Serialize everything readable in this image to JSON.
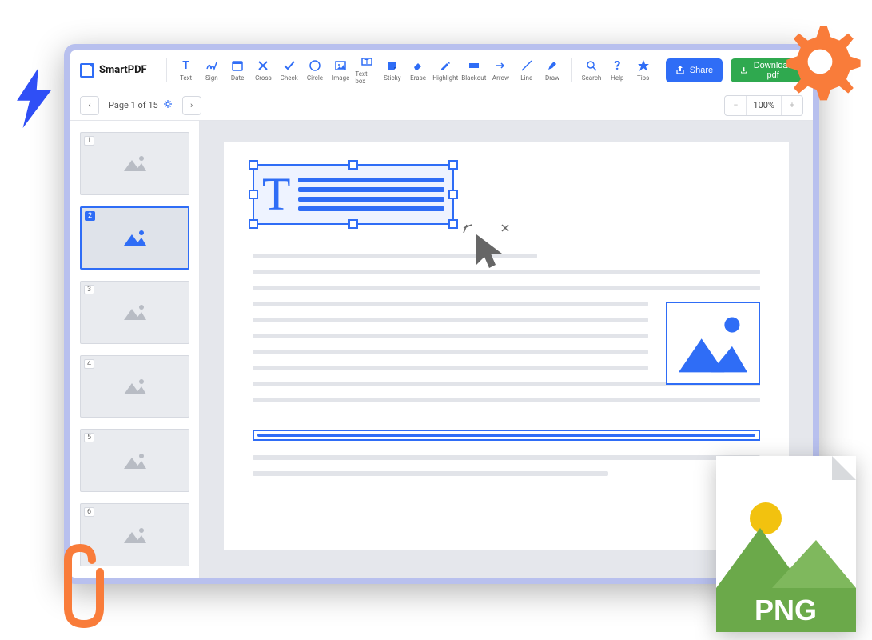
{
  "app": {
    "name": "SmartPDF"
  },
  "tools": [
    {
      "id": "text",
      "label": "Text"
    },
    {
      "id": "sign",
      "label": "Sign"
    },
    {
      "id": "date",
      "label": "Date"
    },
    {
      "id": "cross",
      "label": "Cross"
    },
    {
      "id": "check",
      "label": "Check"
    },
    {
      "id": "circle",
      "label": "Circle"
    },
    {
      "id": "image",
      "label": "Image"
    },
    {
      "id": "textbox",
      "label": "Text box"
    },
    {
      "id": "sticky",
      "label": "Sticky"
    },
    {
      "id": "erase",
      "label": "Erase"
    },
    {
      "id": "highlight",
      "label": "Highlight"
    },
    {
      "id": "blackout",
      "label": "Blackout"
    },
    {
      "id": "arrow",
      "label": "Arrow"
    },
    {
      "id": "line",
      "label": "Line"
    },
    {
      "id": "draw",
      "label": "Draw"
    }
  ],
  "help_tools": [
    {
      "id": "search",
      "label": "Search"
    },
    {
      "id": "help",
      "label": "Help"
    },
    {
      "id": "tips",
      "label": "Tips"
    }
  ],
  "buttons": {
    "share": "Share",
    "download": "Download pdf"
  },
  "pager": {
    "label": "Page 1 of 15"
  },
  "zoom": {
    "value": "100%"
  },
  "thumbnails": [
    1,
    2,
    3,
    4,
    5,
    6
  ],
  "active_thumbnail": 2,
  "png_badge": {
    "label": "PNG"
  },
  "colors": {
    "primary": "#2f6df6",
    "green": "#2fa94f",
    "orange": "#f97c3a"
  }
}
